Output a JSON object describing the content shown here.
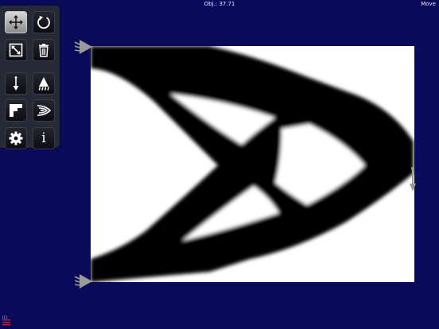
{
  "status": {
    "objective": "Obj.: 37.71",
    "mode": "Move"
  },
  "toolbar": {
    "buttons": [
      {
        "id": "move",
        "icon": "move-arrows-icon",
        "active": true
      },
      {
        "id": "rotate",
        "icon": "rotate-icon",
        "active": false
      },
      {
        "id": "resize",
        "icon": "resize-diagonal-icon",
        "active": false
      },
      {
        "id": "delete",
        "icon": "trash-icon",
        "active": false
      },
      {
        "id": "force",
        "icon": "force-arrow-icon",
        "active": false
      },
      {
        "id": "support",
        "icon": "support-icon",
        "active": false
      },
      {
        "id": "passive",
        "icon": "stair-step-icon",
        "active": false
      },
      {
        "id": "filter",
        "icon": "chevron-swoosh-icon",
        "active": false
      },
      {
        "id": "settings",
        "icon": "gear-icon",
        "active": false
      },
      {
        "id": "info",
        "icon": "info-icon",
        "glyph": "i",
        "active": false
      }
    ]
  },
  "corner": {
    "label": "[1]"
  },
  "colors": {
    "background": "#0a0a5a",
    "toolbar": "#262a36",
    "design_domain": "#ffffff",
    "material": "#000000",
    "marker": "#9a9a9a"
  }
}
